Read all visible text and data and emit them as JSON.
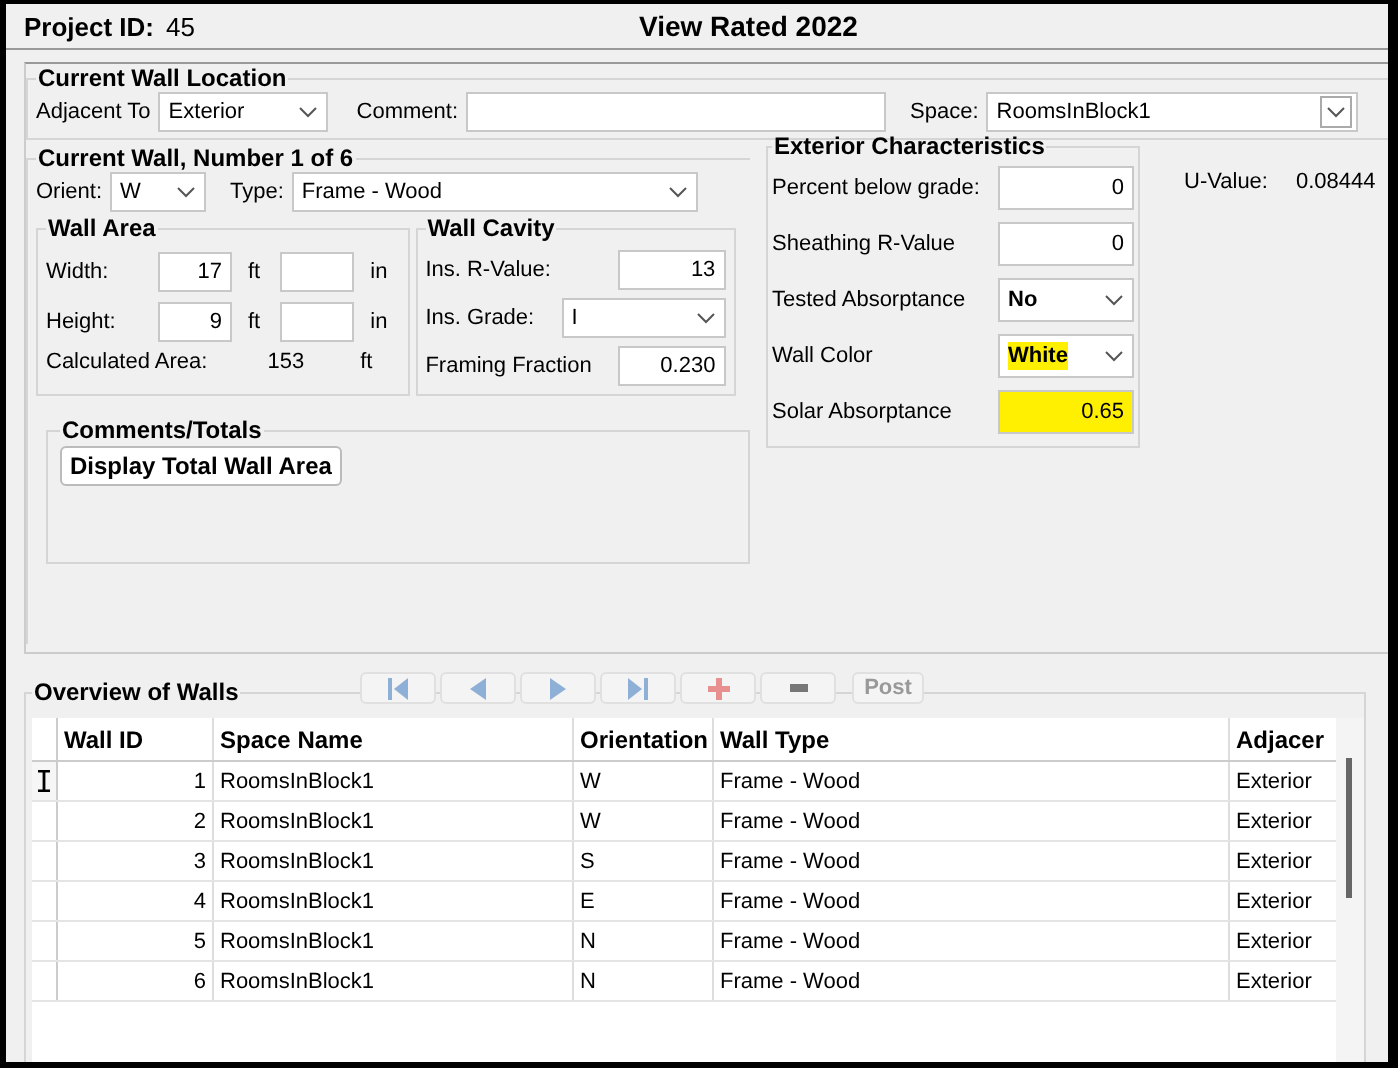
{
  "title_bar": {
    "project_label": "Project ID:",
    "project_id": "45",
    "title": "View Rated 2022"
  },
  "location": {
    "legend": "Current Wall Location",
    "adjacent_label": "Adjacent To",
    "adjacent_value": "Exterior",
    "comment_label": "Comment:",
    "space_label": "Space:",
    "space_value": "RoomsInBlock1"
  },
  "current_wall": {
    "legend": "Current Wall, Number 1 of 6",
    "orient_label": "Orient:",
    "orient_value": "W",
    "type_label": "Type:",
    "type_value": "Frame - Wood"
  },
  "wall_area": {
    "legend": "Wall Area",
    "width_label": "Width:",
    "width_ft": "17",
    "ft1": "ft",
    "in1": "in",
    "height_label": "Height:",
    "height_ft": "9",
    "ft2": "ft",
    "in2": "in",
    "calc_label": "Calculated Area:",
    "calc_value": "153",
    "calc_unit": "ft"
  },
  "wall_cavity": {
    "legend": "Wall Cavity",
    "r_label": "Ins. R-Value:",
    "r_value": "13",
    "grade_label": "Ins. Grade:",
    "grade_value": "I",
    "framing_label": "Framing Fraction",
    "framing_value": "0.230"
  },
  "exterior": {
    "legend": "Exterior Characteristics",
    "rows": [
      {
        "kind": "input",
        "label": "Percent below grade:",
        "value": "0",
        "highlighted": false
      },
      {
        "kind": "input",
        "label": "Sheathing R-Value",
        "value": "0",
        "highlighted": false
      },
      {
        "kind": "select",
        "label": "Tested Absorptance",
        "value": "No",
        "highlighted": false
      },
      {
        "kind": "select",
        "label": "Wall Color",
        "value": "White",
        "highlighted": true
      },
      {
        "kind": "input",
        "label": "Solar Absorptance",
        "value": "0.65",
        "highlighted": true
      }
    ]
  },
  "u_value": {
    "label": "U-Value:",
    "value": "0.08444"
  },
  "comments": {
    "legend": "Comments/Totals",
    "button": "Display Total Wall Area"
  },
  "overview": {
    "legend": "Overview of Walls",
    "nav_buttons": [
      {
        "kind": "first"
      },
      {
        "kind": "prev"
      },
      {
        "kind": "next"
      },
      {
        "kind": "last"
      },
      {
        "kind": "add"
      },
      {
        "kind": "delete"
      }
    ],
    "post": {
      "label": "Post",
      "disabled": true
    },
    "columns": [
      "Wall ID",
      "Space Name",
      "Orientation",
      "Wall Type",
      "Adjacer"
    ],
    "rows": [
      {
        "selected": true,
        "cells": [
          "1",
          "RoomsInBlock1",
          "W",
          "Frame - Wood",
          "Exterior"
        ]
      },
      {
        "selected": false,
        "cells": [
          "2",
          "RoomsInBlock1",
          "W",
          "Frame - Wood",
          "Exterior"
        ]
      },
      {
        "selected": false,
        "cells": [
          "3",
          "RoomsInBlock1",
          "S",
          "Frame - Wood",
          "Exterior"
        ]
      },
      {
        "selected": false,
        "cells": [
          "4",
          "RoomsInBlock1",
          "E",
          "Frame - Wood",
          "Exterior"
        ]
      },
      {
        "selected": false,
        "cells": [
          "5",
          "RoomsInBlock1",
          "N",
          "Frame - Wood",
          "Exterior"
        ]
      },
      {
        "selected": false,
        "cells": [
          "6",
          "RoomsInBlock1",
          "N",
          "Frame - Wood",
          "Exterior"
        ]
      }
    ]
  }
}
